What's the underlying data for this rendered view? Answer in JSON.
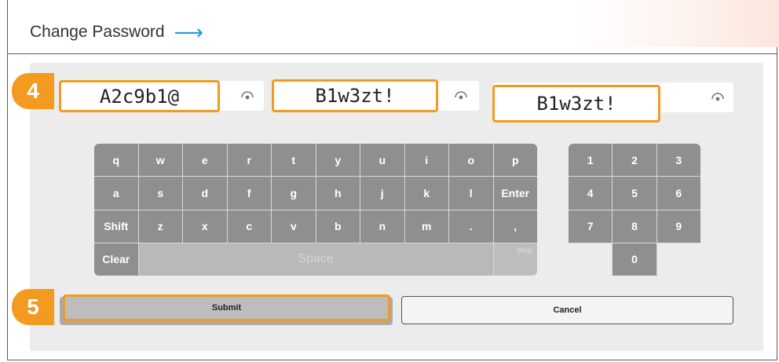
{
  "header": {
    "title": "Change Password",
    "arrow_icon": "arrow-right-icon",
    "arrow_color": "#1aa0d8"
  },
  "fields": [
    {
      "name": "current-password",
      "value": "A2c9b1@"
    },
    {
      "name": "new-password",
      "value": "B1w3zt!"
    },
    {
      "name": "confirm-password",
      "value": "B1w3zt!"
    }
  ],
  "annotations": {
    "step4": "4",
    "step5": "5",
    "color": "#f39a21"
  },
  "keyboard": {
    "rows": [
      [
        "q",
        "w",
        "e",
        "r",
        "t",
        "y",
        "u",
        "i",
        "o",
        "p"
      ],
      [
        "a",
        "s",
        "d",
        "f",
        "g",
        "h",
        "j",
        "k",
        "l",
        "Enter"
      ],
      [
        "Shift",
        "z",
        "x",
        "c",
        "v",
        "b",
        "n",
        "m",
        ".",
        ","
      ],
      [
        "Clear",
        "Space",
        "Bksp"
      ]
    ]
  },
  "numpad": {
    "keys": [
      "1",
      "2",
      "3",
      "4",
      "5",
      "6",
      "7",
      "8",
      "9",
      "0"
    ]
  },
  "buttons": {
    "submit": "Submit",
    "cancel": "Cancel"
  }
}
